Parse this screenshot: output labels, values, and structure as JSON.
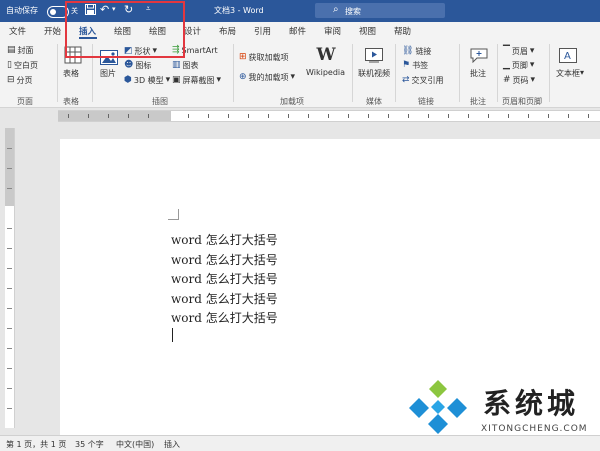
{
  "titlebar": {
    "autosave_label": "自动保存",
    "autosave_state": "关",
    "doc_title": "文档3 - Word",
    "search_placeholder": "搜索",
    "qat_icons": [
      "save-icon",
      "undo-icon",
      "redo-icon",
      "customize-icon"
    ]
  },
  "tabs": [
    "文件",
    "开始",
    "插入",
    "绘图",
    "设计",
    "布局",
    "引用",
    "邮件",
    "审阅",
    "视图",
    "帮助"
  ],
  "active_tab": "插入",
  "ribbon": {
    "pages": {
      "items": [
        "封面",
        "空白页",
        "分页"
      ],
      "label": "页面"
    },
    "tables": {
      "button": "表格",
      "label": "表格"
    },
    "illustrations": {
      "picture": "图片",
      "shapes": "形状",
      "icons": "图标",
      "model3d": "3D 模型",
      "smartart": "SmartArt",
      "chart": "图表",
      "screenshot": "屏幕截图",
      "label": "插图"
    },
    "addins": {
      "get": "获取加载项",
      "mine": "我的加载项",
      "wikipedia": "Wikipedia",
      "label": "加载项"
    },
    "media": {
      "video": "联机视频",
      "label": "媒体"
    },
    "links": {
      "items": [
        "链接",
        "书签",
        "交叉引用"
      ],
      "label": "链接"
    },
    "comments": {
      "button": "批注",
      "label": "批注"
    },
    "headerfooter": {
      "items": [
        "页眉",
        "页脚",
        "页码"
      ],
      "label": "页眉和页脚"
    },
    "text": {
      "button": "文本框"
    }
  },
  "document": {
    "lines": [
      "word 怎么打大括号",
      "word 怎么打大括号",
      "word 怎么打大括号",
      "word 怎么打大括号",
      "word 怎么打大括号"
    ]
  },
  "watermark": {
    "text": "系统城",
    "sub": "XITONGCHENG.COM"
  },
  "status": {
    "page": "第 1 页，共 1 页",
    "words": "35 个字",
    "language": "中文(中国)",
    "mode": "插入"
  },
  "colors": {
    "titlebar": "#2b579a",
    "highlight": "#e2373f",
    "wm_blue": "#1e8fd6"
  }
}
